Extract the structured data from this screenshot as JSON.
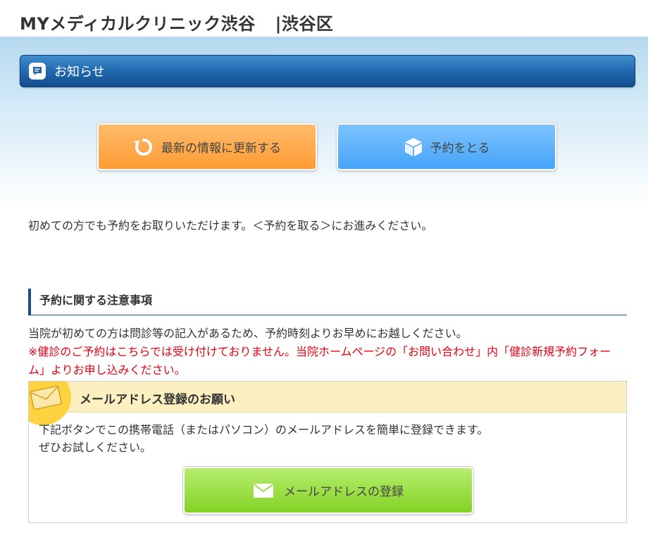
{
  "header": {
    "site_title": "MYメディカルクリニック渋谷",
    "district": "|渋谷区"
  },
  "notice_bar": {
    "label": "お知らせ",
    "icon": "chat-bubble-icon"
  },
  "buttons": {
    "refresh_label": "最新の情報に更新する",
    "refresh_icon": "refresh-icon",
    "reserve_label": "予約をとる",
    "reserve_icon": "box-icon"
  },
  "intro_text": "初めての方でも予約をお取りいただけます。＜予約を取る＞にお進みください。",
  "notes": {
    "title": "予約に関する注意事項",
    "line1": "当院が初めての方は問診等の記入があるため、予約時刻よりお早めにお越しください。",
    "warning": "※健診のご予約はこちらでは受け付けておりません。当院ホームページの「お問い合わせ」内「健診新規予約フォーム」よりお申し込みください。"
  },
  "mail_section": {
    "title": "メールアドレス登録のお願い",
    "desc_line1": "下記ボタンでこの携帯電話（またはパソコン）のメールアドレスを簡単に登録できます。",
    "desc_line2": "ぜひお試しください。",
    "button_label": "メールアドレスの登録",
    "icon": "envelope-icon"
  },
  "colors": {
    "notice_bar": "#1f66ad",
    "refresh_button": "#ff9c35",
    "reserve_button": "#46a3f7",
    "mail_button": "#84d125",
    "warning_text": "#e60012",
    "mail_header": "#fdf0c0"
  }
}
